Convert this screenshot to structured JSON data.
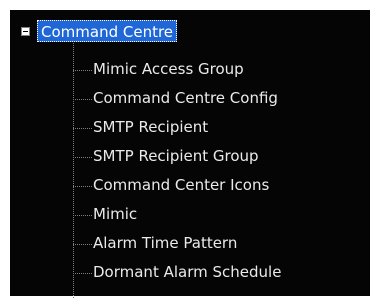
{
  "tree": {
    "root": {
      "label": "Command Centre",
      "expander": "−"
    },
    "items": [
      {
        "label": "Mimic Access Group"
      },
      {
        "label": "Command Centre Config"
      },
      {
        "label": "SMTP Recipient"
      },
      {
        "label": "SMTP Recipient Group"
      },
      {
        "label": "Command Center Icons"
      },
      {
        "label": "Mimic"
      },
      {
        "label": "Alarm Time Pattern"
      },
      {
        "label": "Dormant Alarm Schedule"
      }
    ]
  },
  "colors": {
    "panel_background": "#050505",
    "selection": "#1f67d6",
    "item_text": "#eaeaea"
  }
}
